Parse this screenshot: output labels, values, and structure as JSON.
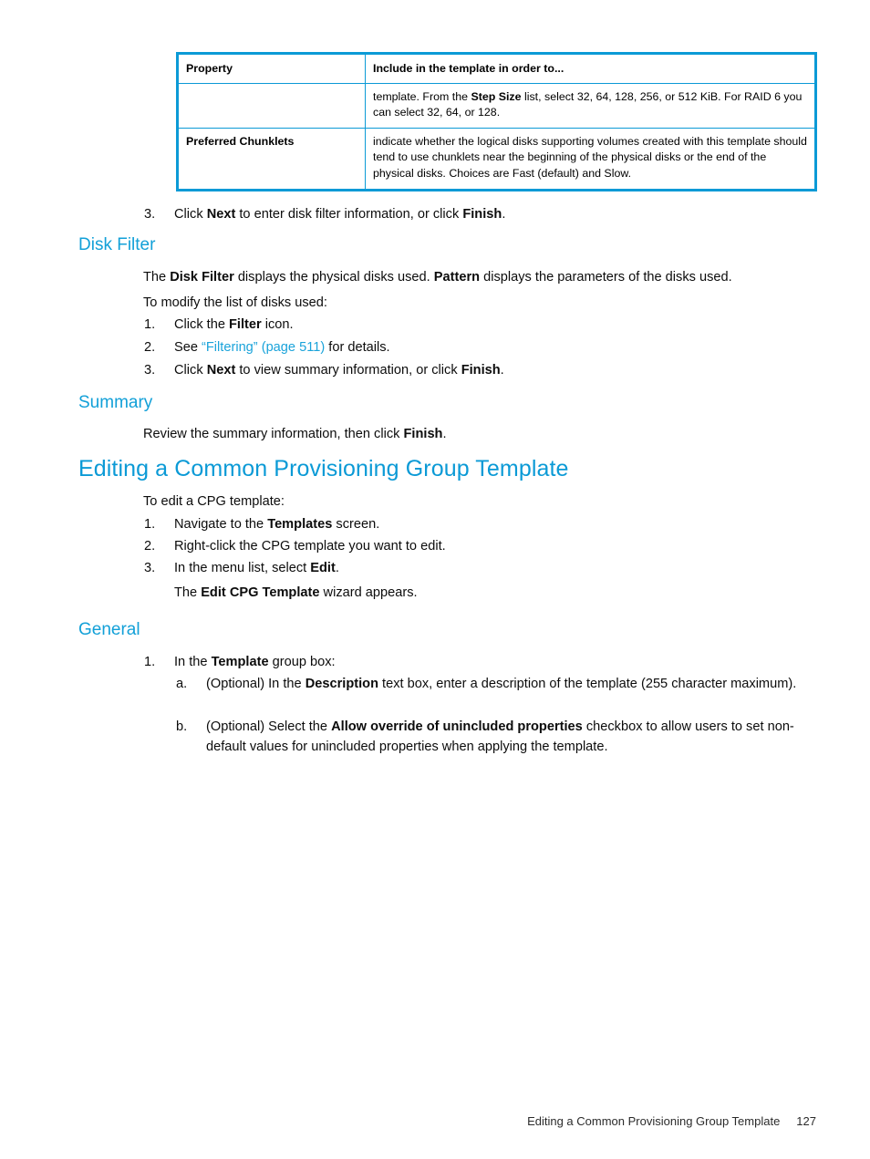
{
  "table": {
    "headers": [
      "Property",
      "Include in the template in order to..."
    ],
    "rows": [
      {
        "property": "",
        "description_parts": [
          {
            "text": "template. From the ",
            "bold": false
          },
          {
            "text": "Step Size",
            "bold": true
          },
          {
            "text": " list, select 32, 64, 128, 256, or 512 KiB. For RAID 6 you can select 32, 64, or 128.",
            "bold": false
          }
        ]
      },
      {
        "property": "Preferred Chunklets",
        "description_parts": [
          {
            "text": "indicate whether the logical disks supporting volumes created with this template should tend to use chunklets near the beginning of the physical disks or the end of the physical disks. Choices are Fast (default) and Slow.",
            "bold": false
          }
        ]
      }
    ]
  },
  "content": {
    "step3_top": {
      "marker": "3.",
      "parts": [
        {
          "text": "Click ",
          "bold": false
        },
        {
          "text": "Next",
          "bold": true
        },
        {
          "text": " to enter disk filter information, or click ",
          "bold": false
        },
        {
          "text": "Finish",
          "bold": true
        },
        {
          "text": ".",
          "bold": false
        }
      ]
    },
    "disk_filter_heading": "Disk Filter",
    "disk_filter_para": [
      {
        "text": "The ",
        "bold": false
      },
      {
        "text": "Disk Filter",
        "bold": true
      },
      {
        "text": " displays the physical disks used. ",
        "bold": false
      },
      {
        "text": "Pattern",
        "bold": true
      },
      {
        "text": " displays the parameters of the disks used.",
        "bold": false
      }
    ],
    "disk_filter_intro": "To modify the list of disks used:",
    "disk_filter_steps": [
      {
        "marker": "1.",
        "parts": [
          {
            "text": "Click the ",
            "bold": false
          },
          {
            "text": "Filter",
            "bold": true
          },
          {
            "text": " icon.",
            "bold": false
          }
        ]
      },
      {
        "marker": "2.",
        "parts": [
          {
            "text": "See ",
            "bold": false
          },
          {
            "text": "“Filtering” (page 511)",
            "bold": false,
            "link": true
          },
          {
            "text": " for details.",
            "bold": false
          }
        ]
      },
      {
        "marker": "3.",
        "parts": [
          {
            "text": "Click ",
            "bold": false
          },
          {
            "text": "Next",
            "bold": true
          },
          {
            "text": " to view summary information, or click ",
            "bold": false
          },
          {
            "text": "Finish",
            "bold": true
          },
          {
            "text": ".",
            "bold": false
          }
        ]
      }
    ],
    "summary_heading": "Summary",
    "summary_para": [
      {
        "text": "Review the summary information, then click ",
        "bold": false
      },
      {
        "text": "Finish",
        "bold": true
      },
      {
        "text": ".",
        "bold": false
      }
    ],
    "editing_heading": "Editing a Common Provisioning Group Template",
    "editing_intro": "To edit a CPG template:",
    "editing_steps": [
      {
        "marker": "1.",
        "parts": [
          {
            "text": "Navigate to the ",
            "bold": false
          },
          {
            "text": "Templates",
            "bold": true
          },
          {
            "text": " screen.",
            "bold": false
          }
        ]
      },
      {
        "marker": "2.",
        "parts": [
          {
            "text": "Right-click the CPG template you want to edit.",
            "bold": false
          }
        ]
      },
      {
        "marker": "3.",
        "parts": [
          {
            "text": "In the menu list, select ",
            "bold": false
          },
          {
            "text": "Edit",
            "bold": true
          },
          {
            "text": ".",
            "bold": false
          }
        ]
      }
    ],
    "wizard_note": [
      {
        "text": "The ",
        "bold": false
      },
      {
        "text": "Edit CPG Template",
        "bold": true
      },
      {
        "text": " wizard appears.",
        "bold": false
      }
    ],
    "general_heading": "General",
    "general_step1": {
      "marker": "1.",
      "parts": [
        {
          "text": "In the ",
          "bold": false
        },
        {
          "text": "Template",
          "bold": true
        },
        {
          "text": " group box:",
          "bold": false
        }
      ]
    },
    "general_substeps": [
      {
        "marker": "a.",
        "parts": [
          {
            "text": "(Optional) In the ",
            "bold": false
          },
          {
            "text": "Description",
            "bold": true
          },
          {
            "text": " text box, enter a description of the template (255 character maximum).",
            "bold": false
          }
        ]
      },
      {
        "marker": "b.",
        "parts": [
          {
            "text": "(Optional) Select the ",
            "bold": false
          },
          {
            "text": "Allow override of unincluded properties",
            "bold": true
          },
          {
            "text": " checkbox to allow users to set non-default values for unincluded properties when applying the template.",
            "bold": false
          }
        ]
      }
    ]
  },
  "footer": {
    "title": "Editing a Common Provisioning Group Template",
    "page_number": "127"
  },
  "colors": {
    "heading_blue": "#0b9ad6",
    "link_blue": "#1aa3da",
    "table_border": "#0b9ad6",
    "body_text": "#0c0c0c"
  }
}
